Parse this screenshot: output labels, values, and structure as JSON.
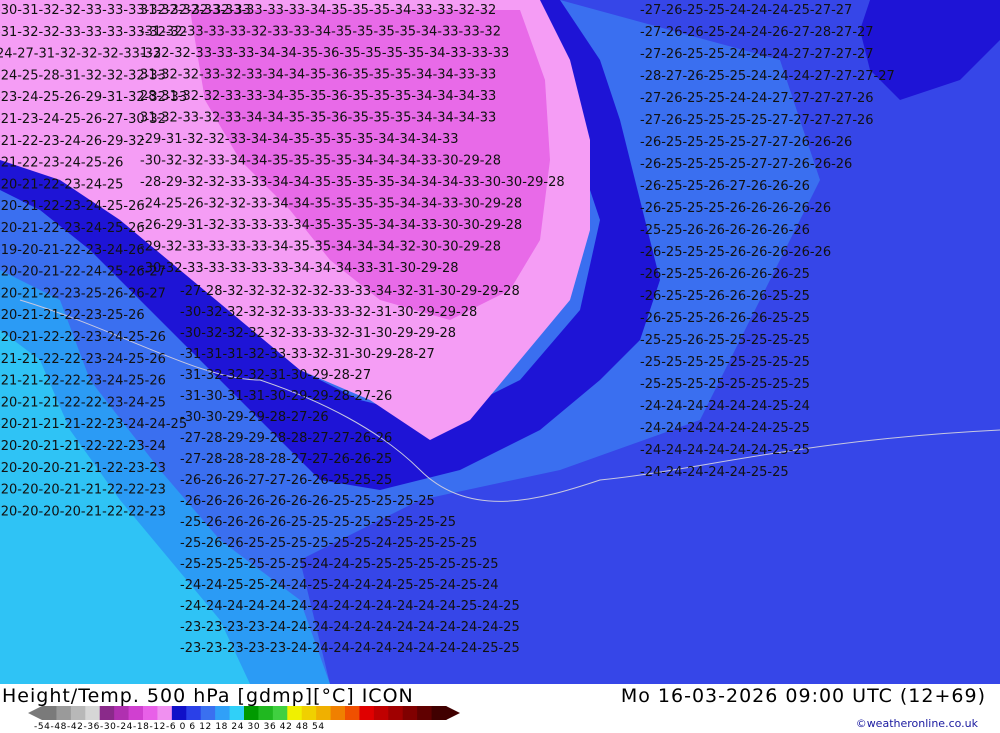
{
  "header": {
    "title": "Height/Temp. 500 hPa [gdmp][°C] ICON",
    "datetime": "Mo 16-03-2026 09:00 UTC (12+69)"
  },
  "legend": {
    "ticks": "-54-48-42-36-30-24-18-12-6  0  6  12 18 24 30 36 42 48 54",
    "colors": [
      "#7a7a7a",
      "#9a9a9a",
      "#b8b8b8",
      "#d6d6d6",
      "#8a2a8a",
      "#b030b0",
      "#d040d0",
      "#e860e8",
      "#f090f0",
      "#1010c8",
      "#2a40e8",
      "#3a70f0",
      "#30a0f8",
      "#30d0f8",
      "#009a00",
      "#20b820",
      "#40d040",
      "#f0f000",
      "#f0d000",
      "#f0b000",
      "#f08000",
      "#f05000",
      "#e00000",
      "#c00000",
      "#a00000",
      "#800000",
      "#600000",
      "#400000"
    ]
  },
  "credit": "©weatheronline.co.uk",
  "map": {
    "colors": {
      "cyan": "#2fc3f5",
      "light_blue": "#2b9bf5",
      "mid_blue": "#3a6ff0",
      "blue": "#3646e8",
      "dark_blue": "#1e14d6",
      "magenta_light": "#f59df5",
      "magenta": "#e86ae8"
    },
    "labels": [
      {
        "t": "31-32-32-33-33-33-33-33-34-35-35-35-34-33-33-32-32"
      },
      {
        "t": "-31-32-33-33-33-32-33-33-34-35-35-35-35-34-33-33-32"
      },
      {
        "t": "1-32-32-33-33-33-34-34-35-36-35-35-35-35-34-33-33-33"
      },
      {
        "t": "31-32-32-33-32-33-34-34-35-36-35-35-35-34-34-33-33"
      },
      {
        "t": "28-31-32-32-33-33-34-35-35-36-35-35-35-34-34-34-33"
      },
      {
        "t": "31-32-33-32-33-34-34-35-35-36-35-35-35-34-34-34-33"
      },
      {
        "t": "-29-31-32-32-33-34-34-35-35-35-35-34-34-34-33"
      },
      {
        "t": "-30-32-32-33-34-34-35-35-35-35-34-34-34-33-30-29-28"
      },
      {
        "t": "-28-29-32-32-33-33-34-34-35-35-35-35-34-34-34-33-30-30-29-28"
      },
      {
        "t": "-24-25-26-32-32-33-34-34-35-35-35-35-34-34-33-30-29-28"
      },
      {
        "t": "-26-29-31-32-33-33-33-34-35-35-35-34-34-33-30-30-29-28"
      },
      {
        "t": "-29-32-33-33-33-33-34-35-35-34-34-34-32-30-30-29-28"
      },
      {
        "t": "-30-32-33-33-33-33-33-34-34-34-33-31-30-29-28"
      },
      {
        "t": "-27-28-32-32-32-32-32-33-33-34-32-31-30-29-29-28"
      },
      {
        "t": "-30-32-32-32-32-33-33-33-32-31-30-29-29-28"
      },
      {
        "t": "-30-32-32-32-32-33-33-32-31-30-29-29-28"
      },
      {
        "t": "-31-31-31-32-33-33-32-31-30-29-28-27"
      },
      {
        "t": "-31-32-32-32-31-30-29-28-27"
      },
      {
        "t": "-31-30-31-31-30-29-29-28-27-26"
      },
      {
        "t": "-30-30-29-29-28-27-26"
      },
      {
        "t": "-27-28-29-29-28-28-27-27-26-26"
      },
      {
        "t": "-27-28-28-28-28-27-27-26-26-25"
      },
      {
        "t": "-26-26-26-27-27-26-26-25-25-25"
      },
      {
        "t": "-26-26-26-26-26-26-26-25-25-25-25-25"
      },
      {
        "t": "-25-26-26-26-26-25-25-25-25-25-25-25-25"
      },
      {
        "t": "-25-26-26-25-25-25-25-25-25-24-25-25-25-25"
      },
      {
        "t": "-25-25-25-25-25-25-24-24-25-25-25-25-25-25-25"
      },
      {
        "t": "-24-24-25-25-24-24-25-24-24-24-25-25-24-25-24"
      },
      {
        "t": "-24-24-24-24-24-24-24-24-24-24-24-24-24-25-24-25"
      },
      {
        "t": "-23-23-23-23-24-24-24-24-24-24-24-24-24-24-24-25"
      },
      {
        "t": "-23-23-23-23-23-24-24-24-24-24-24-24-24-24-25-25"
      },
      {
        "t": "-27-26-25-25-24-24-24-25-27-27"
      },
      {
        "t": "-27-26-26-25-24-24-26-27-28-27-27"
      },
      {
        "t": "-27-26-25-25-24-24-24-27-27-27-27"
      },
      {
        "t": "-28-27-26-25-25-24-24-24-27-27-27-27"
      },
      {
        "t": "-27-26-25-25-24-24-27-27-27-27-26"
      },
      {
        "t": "-27-26-25-25-25-25-27-27-27-27-26"
      },
      {
        "t": "-26-25-25-25-25-27-27-26-26-26"
      },
      {
        "t": "-26-25-25-25-25-27-27-26-26-26"
      },
      {
        "t": "-26-25-25-26-27-26-26-26"
      },
      {
        "t": "-26-25-25-25-26-26-26-26-26"
      },
      {
        "t": "-25-25-26-26-26-26-26-26"
      },
      {
        "t": "-26-25-25-25-26-26-26-26-26"
      },
      {
        "t": "-26-25-25-26-26-26-26-25"
      },
      {
        "t": "-26-25-25-26-26-26-25-25"
      },
      {
        "t": "-26-25-25-26-26-26-25-25"
      },
      {
        "t": "-25-25-26-25-25-25-25-25"
      },
      {
        "t": "-25-25-25-25-25-25-25-25"
      },
      {
        "t": "-25-25-25-25-25-25-25-25"
      },
      {
        "t": "-24-24-24-24-24-24-25-24"
      },
      {
        "t": "-24-24-24-24-24-24-25-25"
      },
      {
        "t": "-24-24-24-24-24-24-25-25"
      },
      {
        "t": "-24-24-24-24-24-25-25"
      },
      {
        "t": "-30-31-32-32-33-33-33-32-32-32-32-33"
      },
      {
        "t": "-31-32-32-33-33-33-33-32-32"
      },
      {
        "t": "24-27-31-32-32-32-33-32"
      },
      {
        "t": "-24-25-28-31-32-32-32-33"
      },
      {
        "t": "-23-24-25-26-29-31-32-32-33"
      },
      {
        "t": "-21-23-24-25-26-27-30-32"
      },
      {
        "t": "-21-22-23-24-26-29-32"
      },
      {
        "t": "-21-22-23-24-25-26"
      },
      {
        "t": "-20-21-22-23-24-25"
      },
      {
        "t": "-20-21-22-23-24-25-26"
      },
      {
        "t": "-20-21-22-23-24-25-26"
      },
      {
        "t": "-19-20-21-22-23-24-26"
      },
      {
        "t": "-20-20-21-22-24-25-26-27"
      },
      {
        "t": "-20-21-22-23-25-26-26-27"
      },
      {
        "t": "-20-21-21-22-23-25-26"
      },
      {
        "t": "-20-21-22-22-23-24-25-26"
      },
      {
        "t": "-21-21-22-22-23-24-25-26"
      },
      {
        "t": "-21-21-22-22-23-24-25-26"
      },
      {
        "t": "-20-21-21-22-22-23-24-25"
      },
      {
        "t": "-20-21-21-21-22-23-24-24-25"
      },
      {
        "t": "-20-20-21-21-22-22-23-24"
      },
      {
        "t": "-20-20-20-21-21-22-23-23"
      },
      {
        "t": "-20-20-20-21-21-22-22-23"
      },
      {
        "t": "-20-20-20-20-21-22-22-23"
      }
    ]
  }
}
